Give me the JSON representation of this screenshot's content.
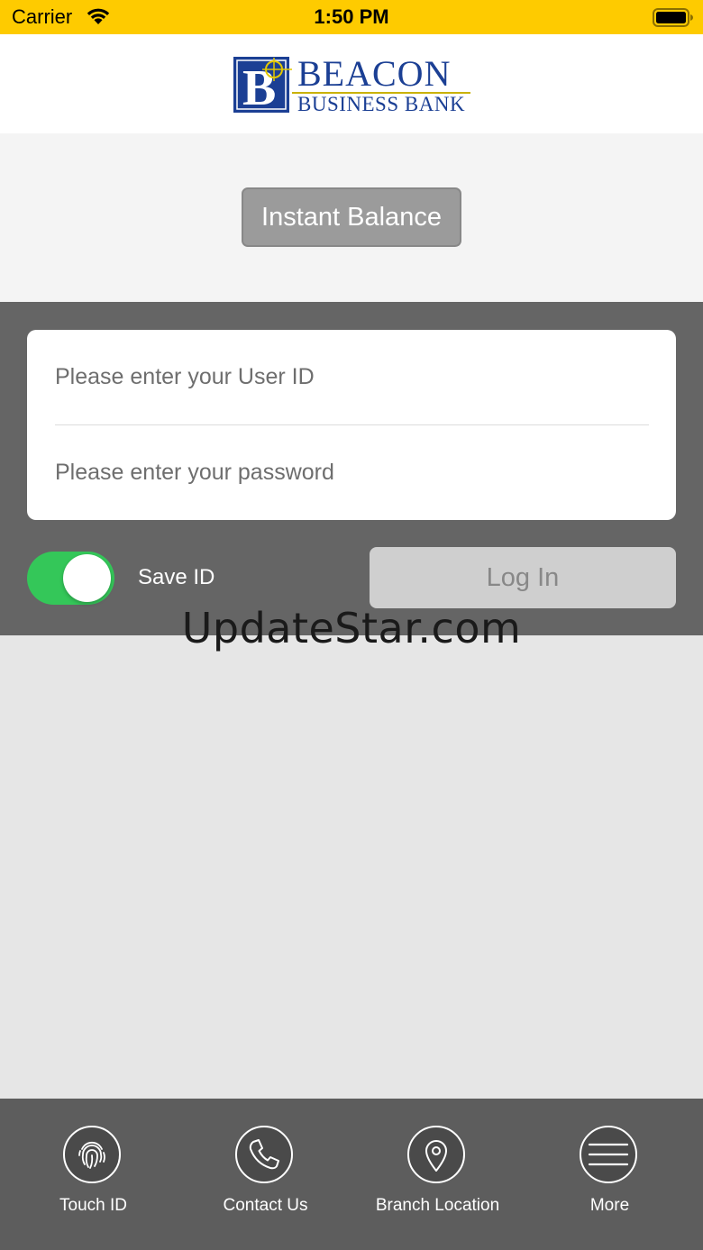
{
  "status_bar": {
    "carrier": "Carrier",
    "time": "1:50 PM"
  },
  "header": {
    "logo_line1": "BEACON",
    "logo_line2": "BUSINESS BANK",
    "logo_letter": "B",
    "brand_color": "#1b3f94"
  },
  "instant_balance": {
    "label": "Instant Balance"
  },
  "login": {
    "user_id_placeholder": "Please enter your User ID",
    "password_placeholder": "Please enter your password",
    "save_id_label": "Save ID",
    "save_id_on": true,
    "login_label": "Log In"
  },
  "watermark": "UpdateStar.com",
  "tab_bar": {
    "items": [
      {
        "label": "Touch ID",
        "icon": "fingerprint-icon"
      },
      {
        "label": "Contact Us",
        "icon": "phone-icon"
      },
      {
        "label": "Branch Location",
        "icon": "location-pin-icon"
      },
      {
        "label": "More",
        "icon": "menu-icon"
      }
    ]
  },
  "colors": {
    "status_bar": "#fecb00",
    "toggle_on": "#34c759",
    "panel": "#656565",
    "tab_bar": "#5d5d5d"
  }
}
